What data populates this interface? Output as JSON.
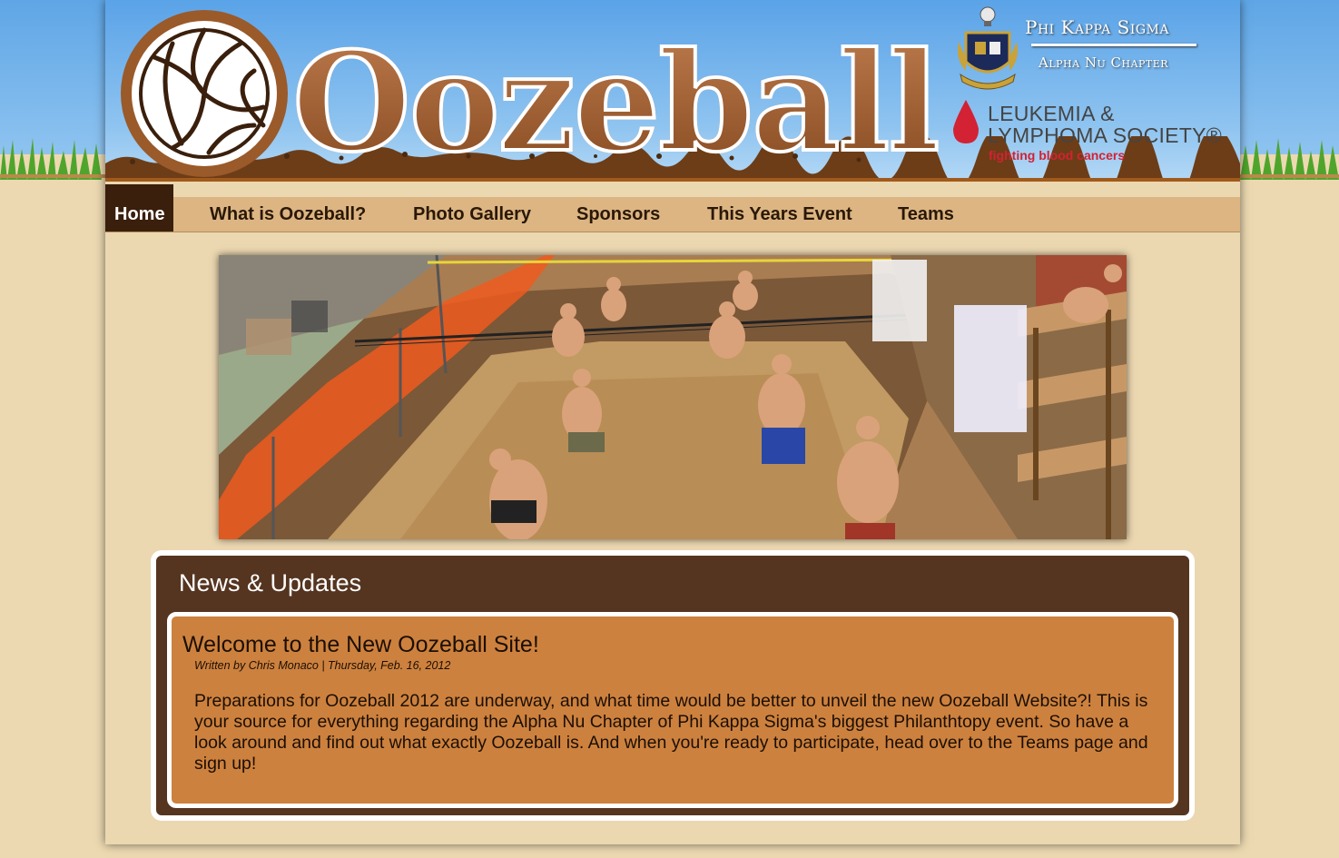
{
  "site": {
    "title": "Oozeball",
    "fraternity": "Phi Kappa Sigma",
    "chapter": "Alpha Nu Chapter",
    "sponsor": {
      "line1": "LEUKEMIA &",
      "line2": "LYMPHOMA SOCIETY®",
      "tagline": "fighting blood cancers"
    }
  },
  "nav": {
    "items": [
      {
        "label": "Home",
        "active": true
      },
      {
        "label": "What is Oozeball?"
      },
      {
        "label": "Photo Gallery"
      },
      {
        "label": "Sponsors"
      },
      {
        "label": "This Years Event"
      },
      {
        "label": "Teams"
      }
    ]
  },
  "news": {
    "heading": "News & Updates",
    "post": {
      "title": "Welcome to the New Oozeball Site!",
      "meta": "Written by Chris Monaco | Thursday, Feb. 16, 2012",
      "body": "Preparations for Oozeball 2012 are underway, and what time would be better to unveil the new Oozeball Website?! This is your source for everything regarding the Alpha Nu Chapter of Phi Kappa Sigma's biggest Philanthtopy event. So have a look around and find out what exactly Oozeball is. And when you're ready to participate, head over to the Teams page and sign up!"
    }
  },
  "icons": {
    "logo": "volleyball-icon",
    "crest": "fraternity-crest-icon",
    "sponsor": "blood-drop-icon"
  },
  "colors": {
    "brand_brown": "#553520",
    "post_orange": "#cd813e",
    "nav_tan": "#dcb583",
    "nav_active": "#3a1f0c",
    "sky_blue": "#5aa3e8",
    "lls_red": "#d32233"
  }
}
